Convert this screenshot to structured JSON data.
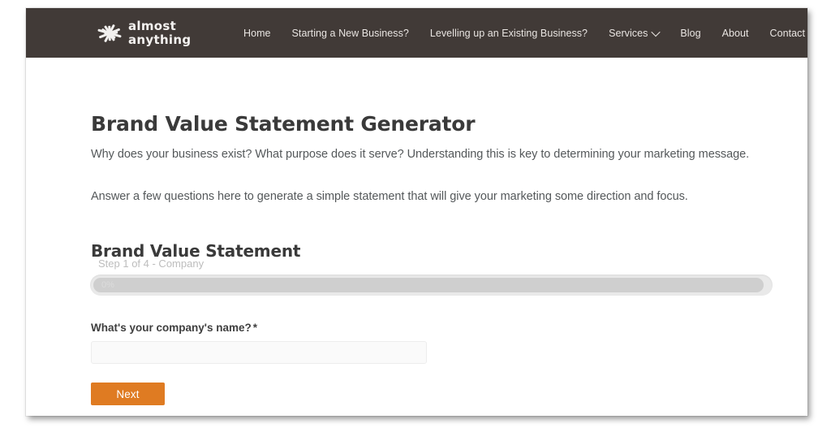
{
  "header": {
    "logo": {
      "line1": "almost",
      "line2": "anything",
      "icon": "starburst-logo-icon"
    },
    "nav": [
      {
        "label": "Home",
        "has_dropdown": false
      },
      {
        "label": "Starting a New Business?",
        "has_dropdown": false
      },
      {
        "label": "Levelling up an Existing Business?",
        "has_dropdown": false
      },
      {
        "label": "Services",
        "has_dropdown": true
      },
      {
        "label": "Blog",
        "has_dropdown": false
      },
      {
        "label": "About",
        "has_dropdown": false
      },
      {
        "label": "Contact",
        "has_dropdown": false
      }
    ],
    "search_icon": "search-icon",
    "background_color": "#413A37"
  },
  "main": {
    "page_title": "Brand Value Statement Generator",
    "paragraph_1": "Why does your business exist? What purpose does it serve? Understanding this is key to determining your marketing message.",
    "paragraph_2": "Answer a few questions here to generate a simple statement that will give your marketing some direction and focus.",
    "form": {
      "heading": "Brand Value Statement",
      "step_indicator": "Step 1 of 4 - Company",
      "progress_percent_label": "0%",
      "progress_percent_value": 0,
      "field_label": "What's your company's name?",
      "required_marker": "*",
      "field_value": "",
      "field_placeholder": "",
      "next_label": "Next",
      "next_color": "#DF7B22"
    }
  }
}
